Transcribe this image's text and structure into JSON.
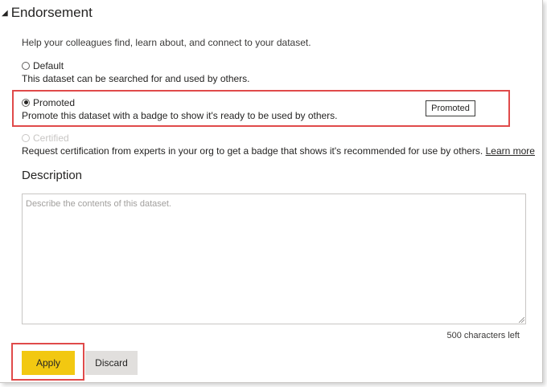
{
  "section": {
    "title": "Endorsement",
    "intro": "Help your colleagues find, learn about, and connect to your dataset."
  },
  "options": [
    {
      "label": "Default",
      "description": "This dataset can be searched for and used by others.",
      "checked": false,
      "disabled": false
    },
    {
      "label": "Promoted",
      "description": "Promote this dataset with a badge to show it's ready to be used by others.",
      "checked": true,
      "disabled": false,
      "badge": "Promoted"
    },
    {
      "label": "Certified",
      "description": "Request certification from experts in your org to get a badge that shows it's recommended for use by others.",
      "checked": false,
      "disabled": true,
      "link": "Learn more"
    }
  ],
  "description": {
    "title": "Description",
    "placeholder": "Describe the contents of this dataset.",
    "value": "",
    "chars_left": "500 characters left"
  },
  "buttons": {
    "apply": "Apply",
    "discard": "Discard"
  },
  "colors": {
    "apply_bg": "#f2c811",
    "highlight_border": "#e04a4a"
  }
}
